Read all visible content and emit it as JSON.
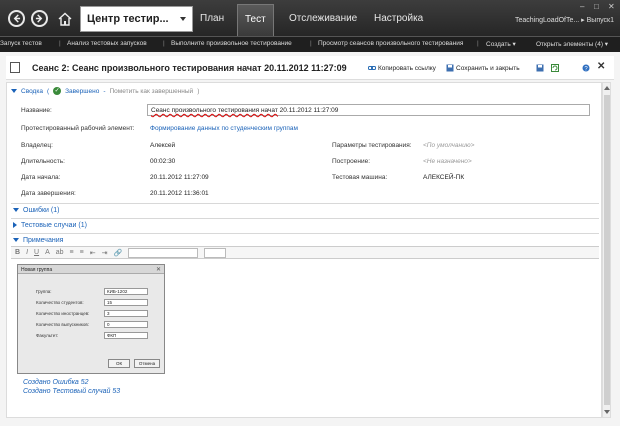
{
  "topbar": {
    "hub_title": "Центр тестир...",
    "tabs": [
      {
        "label": "План",
        "active": false
      },
      {
        "label": "Тест",
        "active": true
      },
      {
        "label": "Отслеживание",
        "active": false
      },
      {
        "label": "Настройка",
        "active": false
      }
    ],
    "project": "TeachingLoadOfTe... ▸ Выпуск1",
    "window_controls": [
      "–",
      "□",
      "✕"
    ]
  },
  "subbar": {
    "items": [
      "Запуск тестов",
      "Анализ тестовых запусков",
      "Выполните произвольное тестирование",
      "Просмотр сеансов произвольного тестирования",
      "Создать ▾",
      "Открыть элементы (4) ▾"
    ]
  },
  "doc": {
    "title": "Сеанс 2: Сеанс произвольного тестирования начат 20.11.2012 11:27:09",
    "copy_link": "Копировать ссылку",
    "save_close": "Сохранить и закрыть"
  },
  "summary": {
    "label": "Сводка",
    "state": "Завершено",
    "mark": "Пометить как завершенный"
  },
  "fields": {
    "name_label": "Название:",
    "name_value_underlined": "Сеанс произвольного тестирования начат",
    "name_value_rest": " 20.11.2012 11:27:09",
    "tested_label": "Протестированный рабочий элемент:",
    "tested_value": "Формирование данных по студенческим группам",
    "owner_label": "Владелец:",
    "owner_value": "Алексей",
    "params_label": "Параметры тестирования:",
    "params_value": "<По умолчанию>",
    "duration_label": "Длительность:",
    "duration_value": "00:02:30",
    "build_label": "Построение:",
    "build_value": "<Не назначено>",
    "start_label": "Дата начала:",
    "start_value": "20.11.2012 11:27:09",
    "machine_label": "Тестовая машина:",
    "machine_value": "АЛЕКСЕЙ-ПК",
    "end_label": "Дата завершения:",
    "end_value": "20.11.2012 11:36:01"
  },
  "sections": {
    "bugs": "Ошибки (1)",
    "testcases": "Тестовые случаи (1)",
    "notes": "Примечания"
  },
  "toolbar": {
    "items": [
      "B",
      "I",
      "U",
      "A",
      "ab",
      "≡",
      "≡",
      "⇤",
      "⇥",
      "🔗"
    ]
  },
  "screenshot": {
    "title": "Новая группа",
    "rows": [
      {
        "label": "Группа:",
        "value": "КИБ-1202"
      },
      {
        "label": "Количество студентов:",
        "value": "15"
      },
      {
        "label": "Количество иностранцев:",
        "value": "3"
      },
      {
        "label": "Количество выпускников:",
        "value": "0"
      },
      {
        "label": "Факультет:",
        "value": "ФКП"
      }
    ],
    "ok": "ОК",
    "cancel": "Отмена"
  },
  "notes_created": [
    "Создано Ошибка 52",
    "Создано Тестовый случай 53"
  ],
  "colors": {
    "accent": "#1a62b8",
    "topbar": "#2e2e2e"
  }
}
